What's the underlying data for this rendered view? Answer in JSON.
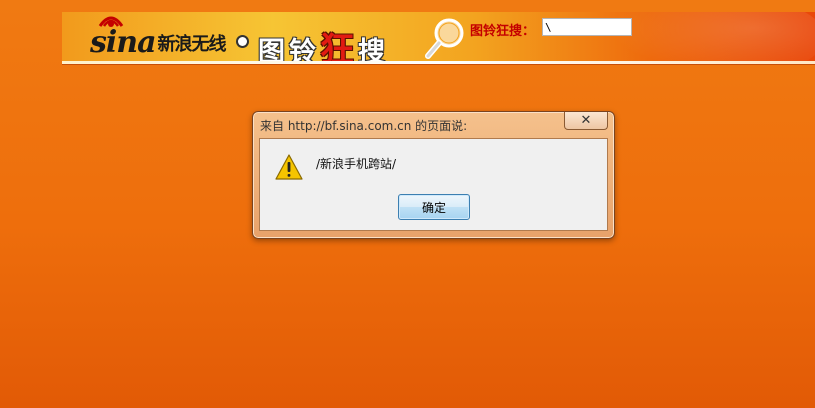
{
  "header": {
    "logo_text": "sina",
    "logo_cn": "新浪无线",
    "brand_prefix": "图铃",
    "brand_highlight": "狂",
    "brand_suffix": "搜",
    "search_label": "图铃狂搜：",
    "search_value": "\\"
  },
  "dialog": {
    "title": "来自 http://bf.sina.com.cn 的页面说:",
    "close_label": "✕",
    "message": "/新浪手机跨站/",
    "ok_label": "确定"
  },
  "colors": {
    "background": "#ee6e0c",
    "warning": "#f5c400",
    "search_label": "#c40000"
  }
}
